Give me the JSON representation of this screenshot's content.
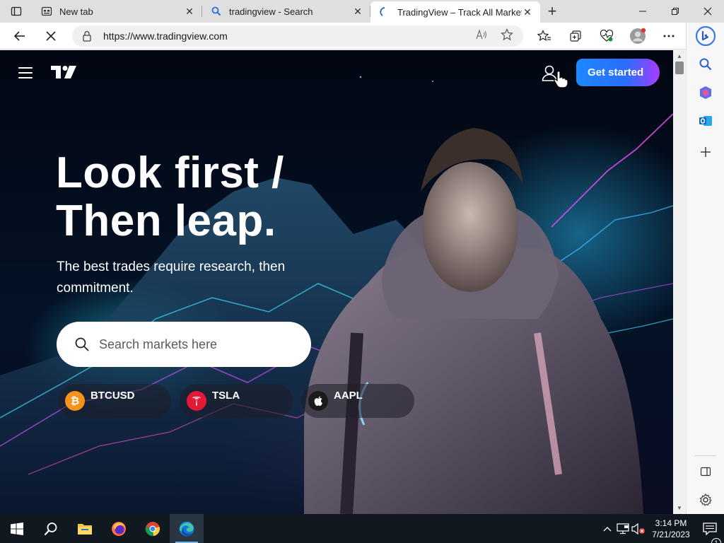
{
  "browser": {
    "tabs": [
      {
        "title": "New tab",
        "icon": "new-tab-icon"
      },
      {
        "title": "tradingview - Search",
        "icon": "search-icon"
      },
      {
        "title": "TradingView – Track All Markets",
        "icon": "tradingview-favicon",
        "active": true
      }
    ],
    "address": {
      "url": "https://www.tradingview.com"
    }
  },
  "page": {
    "header": {
      "cta_label": "Get started"
    },
    "hero": {
      "headline_line1": "Look first /",
      "headline_line2": "Then leap.",
      "subhead": "The best trades require research, then commitment.",
      "search_placeholder": "Search markets here"
    },
    "tickers": [
      {
        "symbol": "BTCUSD",
        "icon": "bitcoin-icon",
        "color": "#f7931a"
      },
      {
        "symbol": "TSLA",
        "icon": "tesla-icon",
        "color": "#e31937"
      },
      {
        "symbol": "AAPL",
        "icon": "apple-icon",
        "color": "#1b1b1b"
      }
    ],
    "colors": {
      "cta_start": "#1e88ff",
      "cta_end": "#a83cff",
      "background": "#041226"
    }
  },
  "taskbar": {
    "apps": [
      "start-icon",
      "search-icon",
      "file-explorer-icon",
      "firefox-icon",
      "chrome-icon",
      "edge-icon"
    ],
    "clock": {
      "time": "3:14 PM",
      "date": "7/21/2023"
    },
    "notifications_count": "1"
  }
}
